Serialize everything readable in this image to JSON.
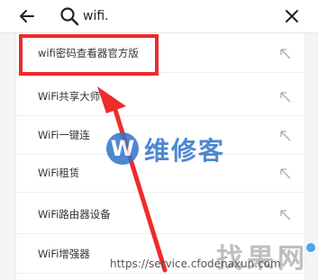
{
  "search": {
    "query": "wifi.",
    "placeholder": ""
  },
  "results": [
    {
      "label": "wifi密码查看器官方版"
    },
    {
      "label": "WiFi共享大师"
    },
    {
      "label": "WiFi一键连"
    },
    {
      "label": "WiFi租赁"
    },
    {
      "label": "WiFi路由器设备"
    },
    {
      "label": "WiFi增强器"
    }
  ],
  "watermarks": {
    "logo_letter": "W",
    "logo_text": "维修客",
    "site": "找果网",
    "url": "https://service.cfodenaxun.com"
  },
  "colors": {
    "highlight": "#ef2b2b",
    "watermark_blue": "#2f74c8"
  }
}
